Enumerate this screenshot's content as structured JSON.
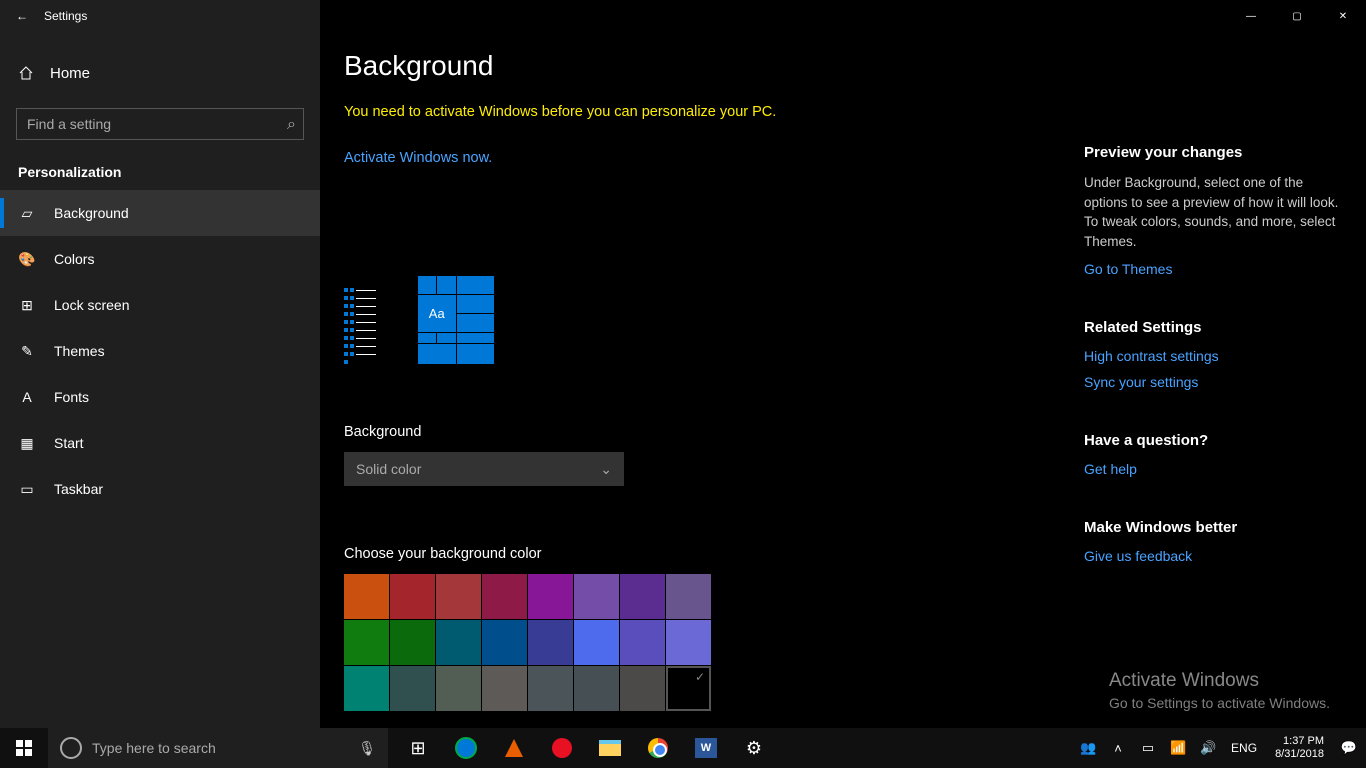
{
  "window": {
    "title": "Settings",
    "min": "—",
    "max": "▢",
    "close": "✕"
  },
  "sidebar": {
    "home": "Home",
    "search_placeholder": "Find a setting",
    "section": "Personalization",
    "items": [
      {
        "label": "Background",
        "icon": "picture-icon",
        "selected": true
      },
      {
        "label": "Colors",
        "icon": "palette-icon",
        "selected": false
      },
      {
        "label": "Lock screen",
        "icon": "lock-icon",
        "selected": false
      },
      {
        "label": "Themes",
        "icon": "themes-icon",
        "selected": false
      },
      {
        "label": "Fonts",
        "icon": "font-icon",
        "selected": false
      },
      {
        "label": "Start",
        "icon": "start-icon",
        "selected": false
      },
      {
        "label": "Taskbar",
        "icon": "taskbar-icon",
        "selected": false
      }
    ]
  },
  "main": {
    "title": "Background",
    "activation_msg": "You need to activate Windows before you can personalize your PC.",
    "activate_link": "Activate Windows now.",
    "preview_tile_text": "Aa",
    "bg_label": "Background",
    "bg_value": "Solid color",
    "color_label": "Choose your background color",
    "colors": [
      "#ca5010",
      "#a4262c",
      "#a4373a",
      "#8e1a47",
      "#881798",
      "#744da9",
      "#5c2d91",
      "#69558d",
      "#107c10",
      "#0b6a0b",
      "#005b70",
      "#004e8c",
      "#393c95",
      "#4f6bed",
      "#5a4ebc",
      "#6b69d6",
      "#008272",
      "#305050",
      "#525e54",
      "#5d5a58",
      "#4a5459",
      "#464f54",
      "#4c4a48",
      "selected"
    ]
  },
  "right": {
    "preview_head": "Preview your changes",
    "preview_text": "Under Background, select one of the options to see a preview of how it will look. To tweak colors, sounds, and more, select Themes.",
    "themes_link": "Go to Themes",
    "related_head": "Related Settings",
    "hc_link": "High contrast settings",
    "sync_link": "Sync your settings",
    "question_head": "Have a question?",
    "help_link": "Get help",
    "better_head": "Make Windows better",
    "feedback_link": "Give us feedback"
  },
  "watermark": {
    "title": "Activate Windows",
    "sub": "Go to Settings to activate Windows."
  },
  "taskbar": {
    "search_placeholder": "Type here to search",
    "lang": "ENG",
    "time": "1:37 PM",
    "date": "8/31/2018",
    "word_label": "W"
  }
}
